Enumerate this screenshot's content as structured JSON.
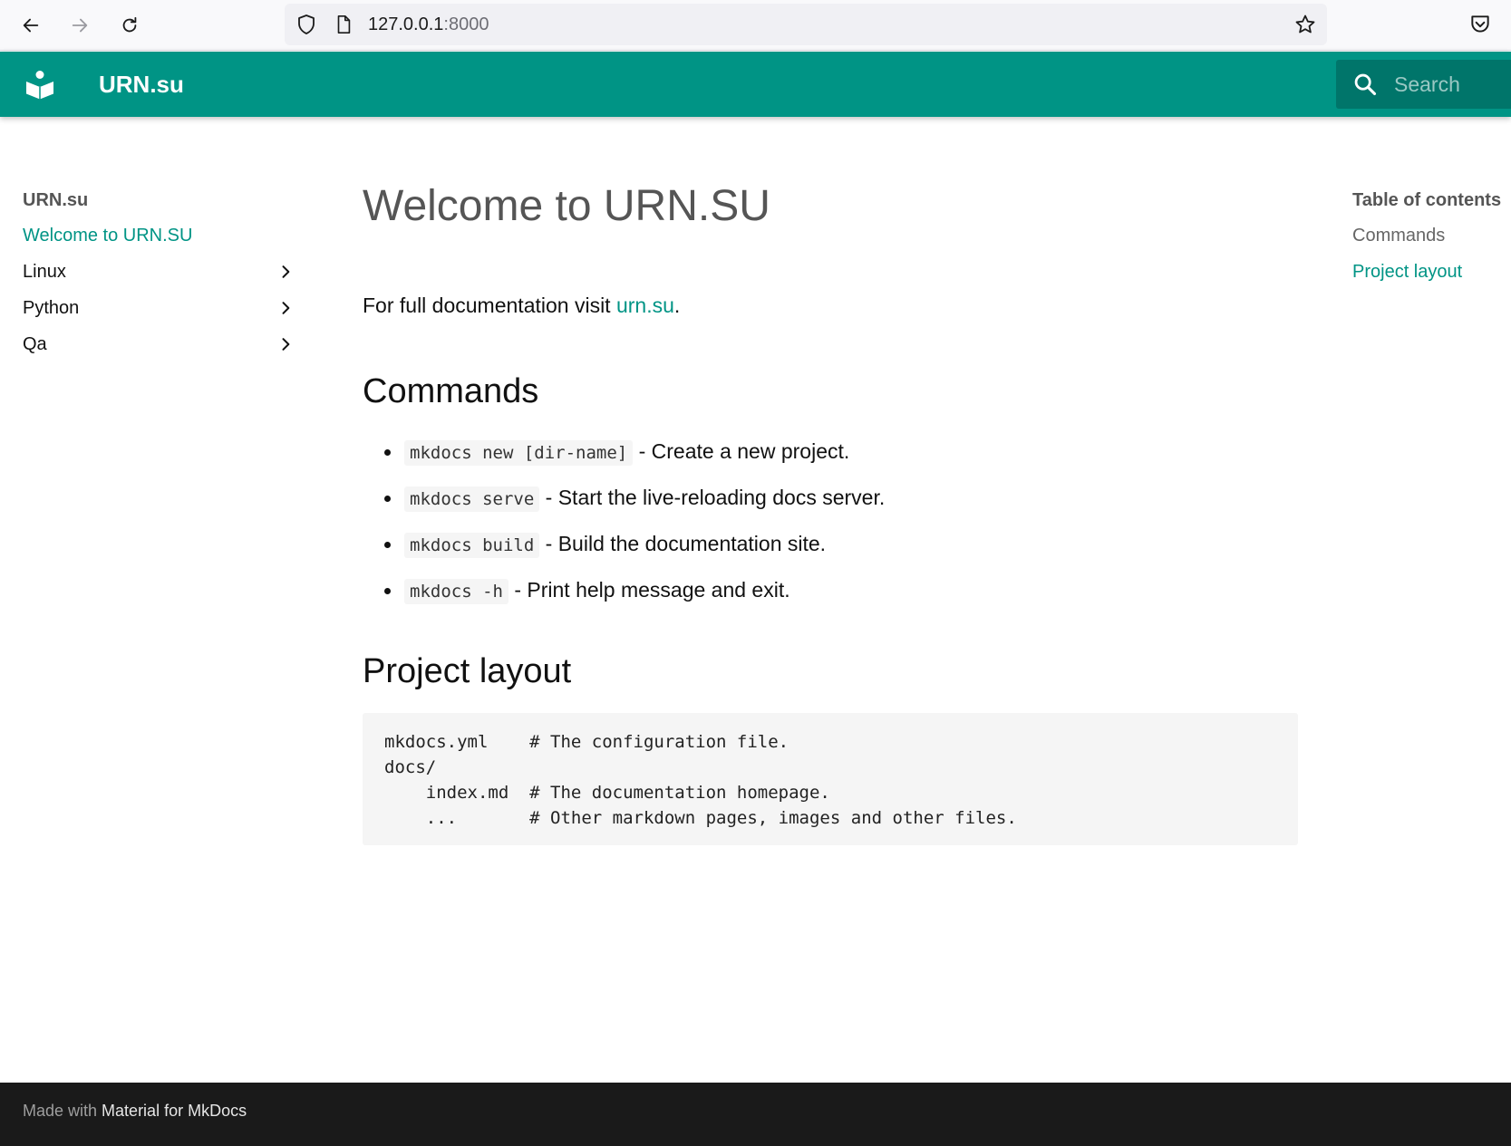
{
  "browser": {
    "url_host": "127.0.0.1",
    "url_port": ":8000"
  },
  "header": {
    "site_title": "URN.su",
    "search_placeholder": "Search"
  },
  "sidebar": {
    "title": "URN.su",
    "items": [
      {
        "label": "Welcome to URN.SU",
        "active": true,
        "expandable": false
      },
      {
        "label": "Linux",
        "active": false,
        "expandable": true
      },
      {
        "label": "Python",
        "active": false,
        "expandable": true
      },
      {
        "label": "Qa",
        "active": false,
        "expandable": true
      }
    ]
  },
  "main": {
    "title": "Welcome to URN.SU",
    "intro_prefix": "For full documentation visit ",
    "intro_link": "urn.su",
    "intro_suffix": ".",
    "commands_heading": "Commands",
    "commands": [
      {
        "code": "mkdocs new [dir-name]",
        "text": " - Create a new project."
      },
      {
        "code": "mkdocs serve",
        "text": " - Start the live-reloading docs server."
      },
      {
        "code": "mkdocs build",
        "text": " - Build the documentation site."
      },
      {
        "code": "mkdocs -h",
        "text": " - Print help message and exit."
      }
    ],
    "layout_heading": "Project layout",
    "code_lines": [
      "mkdocs.yml    # The configuration file.",
      "docs/",
      "    index.md  # The documentation homepage.",
      "    ...       # Other markdown pages, images and other files."
    ]
  },
  "toc": {
    "title": "Table of contents",
    "items": [
      {
        "label": "Commands",
        "active": false
      },
      {
        "label": "Project layout",
        "active": true
      }
    ]
  },
  "footer": {
    "prefix": "Made with ",
    "link": "Material for MkDocs"
  },
  "colors": {
    "primary": "#009485",
    "footer_bg": "#1a1a1a"
  },
  "icons": [
    "back-arrow-icon",
    "forward-arrow-icon",
    "reload-icon",
    "shield-icon",
    "page-icon",
    "star-icon",
    "pocket-icon",
    "logo-icon",
    "search-icon",
    "chevron-right-icon"
  ]
}
